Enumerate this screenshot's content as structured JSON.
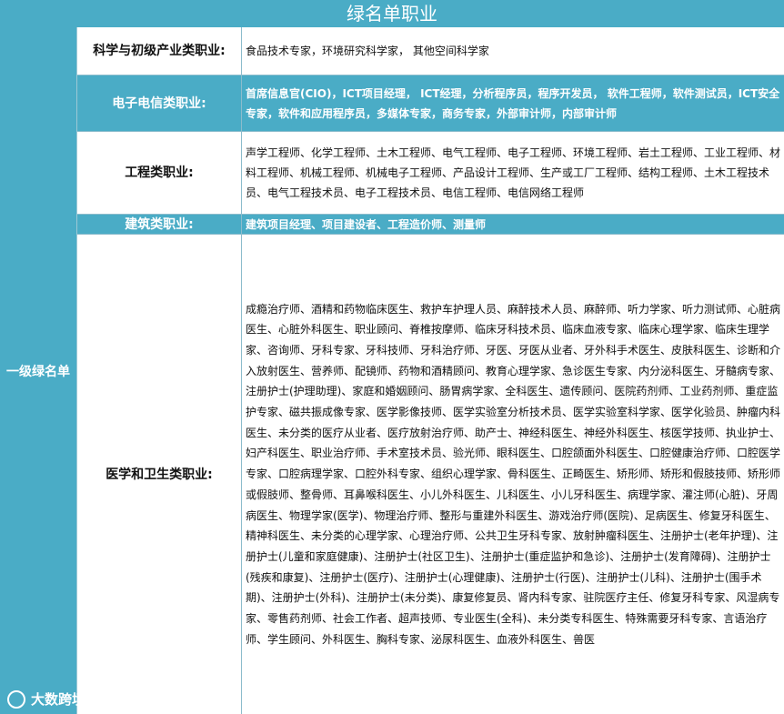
{
  "banner": {
    "title": "绿名单职业"
  },
  "tier_label": "一级绿名单",
  "rows": [
    {
      "category": "科学与初级产业类职业:",
      "jobs": "食品技术专家，环境研究科学家， 其他空间科学家"
    },
    {
      "category": "电子电信类职业:",
      "jobs": "首席信息官(CIO)，ICT项目经理， ICT经理，分析程序员，程序开发员， 软件工程师，软件测试员，ICT安全专家，软件和应用程序员，多媒体专家，商务专家，外部审计师，内部审计师"
    },
    {
      "category": "工程类职业:",
      "jobs": "声学工程师、化学工程师、土木工程师、电气工程师、电子工程师、环境工程师、岩土工程师、工业工程师、材料工程师、机械工程师、机械电子工程师、产品设计工程师、生产或工厂工程师、结构工程师、土木工程技术员、电气工程技术员、电子工程技术员、电信工程师、电信网络工程师"
    },
    {
      "category": "建筑类职业:",
      "jobs": "建筑项目经理、项目建设者、工程造价师、测量师"
    },
    {
      "category": "医学和卫生类职业:",
      "jobs": "成瘾治疗师、酒精和药物临床医生、救护车护理人员、麻醉技术人员、麻醉师、听力学家、听力测试师、心脏病医生、心脏外科医生、职业顾问、脊椎按摩师、临床牙科技术员、临床血液专家、临床心理学家、临床生理学家、咨询师、牙科专家、牙科技师、牙科治疗师、牙医、牙医从业者、牙外科手术医生、皮肤科医生、诊断和介入放射医生、营养师、配镜师、药物和酒精顾问、教育心理学家、急诊医生专家、内分泌科医生、牙髓病专家、注册护士(护理助理)、家庭和婚姻顾问、肠胃病学家、全科医生、遗传顾问、医院药剂师、工业药剂师、重症监护专家、磁共振成像专家、医学影像技师、医学实验室分析技术员、医学实验室科学家、医学化验员、肿瘤内科医生、未分类的医疗从业者、医疗放射治疗师、助产士、神经科医生、神经外科医生、核医学技师、执业护士、妇产科医生、职业治疗师、手术室技术员、验光师、眼科医生、口腔颌面外科医生、口腔健康治疗师、口腔医学专家、口腔病理学家、口腔外科专家、组织心理学家、骨科医生、正畸医生、矫形师、矫形和假肢技师、矫形师或假肢师、整骨师、耳鼻喉科医生、小儿外科医生、儿科医生、小儿牙科医生、病理学家、灌注师(心脏)、牙周病医生、物理学家(医学)、物理治疗师、整形与重建外科医生、游戏治疗师(医院)、足病医生、修复牙科医生、精神科医生、未分类的心理学家、心理治疗师、公共卫生牙科专家、放射肿瘤科医生、注册护士(老年护理)、注册护士(儿童和家庭健康)、注册护士(社区卫生)、注册护士(重症监护和急诊)、注册护士(发育障碍)、注册护士(残疾和康复)、注册护士(医疗)、注册护士(心理健康)、注册护士(行医)、注册护士(儿科)、注册护士(围手术期)、注册护士(外科)、注册护士(未分类)、康复修复员、肾内科专家、驻院医疗主任、修复牙科专家、风湿病专家、零售药剂师、社会工作者、超声技师、专业医生(全科)、未分类专科医生、特殊需要牙科专家、言语治疗师、学生顾问、外科医生、胸科专家、泌尿科医生、血液外科医生、兽医"
    }
  ],
  "logo": {
    "text": "大数跨境",
    "icon": "circle-brand-icon"
  },
  "colors": {
    "accent": "#4aacc6",
    "text": "#111111",
    "on_accent": "#ffffff"
  }
}
